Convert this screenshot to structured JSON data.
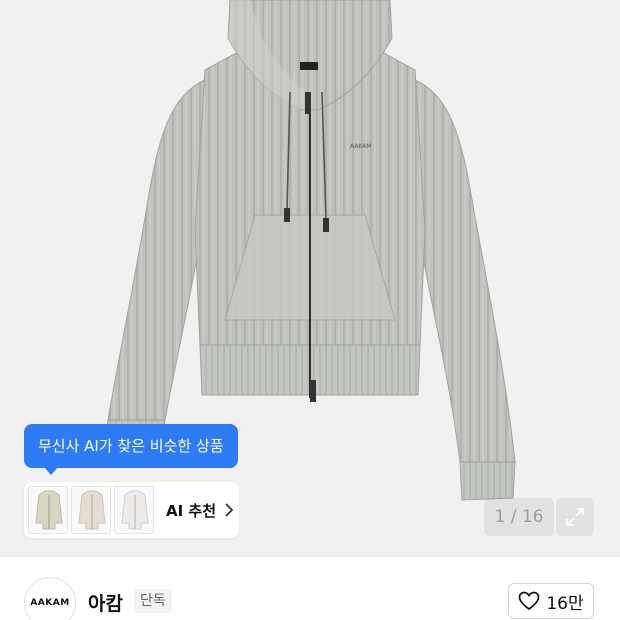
{
  "product": {
    "image_alt": "AAKAM hoodie zip-up",
    "chest_logo": "AAKAM"
  },
  "ai_similar": {
    "tooltip": "무신사 AI가 찾은 비슷한 상품",
    "label": "AI 추천",
    "tooltip_color": "#2d7cf6"
  },
  "gallery": {
    "counter": "1 / 16",
    "expand_icon": "expand-icon"
  },
  "brand": {
    "logo_text": "AAKAM",
    "name": "아캄",
    "badge": "단독",
    "like_count": "16만",
    "like_icon": "heart-icon"
  }
}
